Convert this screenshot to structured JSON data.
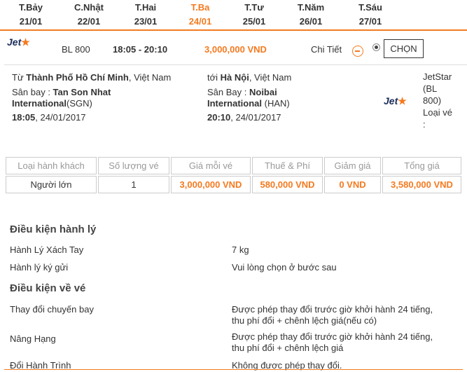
{
  "dates": [
    {
      "weekday": "T.Bảy",
      "date": "21/01",
      "active": false
    },
    {
      "weekday": "C.Nhật",
      "date": "22/01",
      "active": false
    },
    {
      "weekday": "T.Hai",
      "date": "23/01",
      "active": false
    },
    {
      "weekday": "T.Ba",
      "date": "24/01",
      "active": true
    },
    {
      "weekday": "T.Tư",
      "date": "25/01",
      "active": false
    },
    {
      "weekday": "T.Năm",
      "date": "26/01",
      "active": false
    },
    {
      "weekday": "T.Sáu",
      "date": "27/01",
      "active": false
    }
  ],
  "flight": {
    "airline_logo": "Jet",
    "code": "BL 800",
    "time": "18:05 - 20:10",
    "price": "3,000,000 VND",
    "detail_label": "Chi Tiết",
    "select_label": "CHỌN"
  },
  "detail": {
    "from_prefix": "Từ",
    "from_city": "Thành Phố Hồ Chí Minh",
    "from_country": ", Việt Nam",
    "to_prefix": "tới",
    "to_city": "Hà Nội",
    "to_country": ", Việt Nam",
    "from_airport_label": "Sân bay : ",
    "from_airport_name_1": "Tan Son Nhat",
    "from_airport_name_2": "International",
    "from_airport_code": "(SGN)",
    "to_airport_label": "Sân Bay : ",
    "to_airport_name_1": "Noibai",
    "to_airport_name_2": "International",
    "to_airport_code": " (HAN)",
    "depart_time": "18:05",
    "depart_date": ", 24/01/2017",
    "arrive_time": "20:10",
    "arrive_date": ", 24/01/2017",
    "carrier_logo": "Jet",
    "carrier_lines": [
      "JetStar",
      "(BL",
      "800)",
      "Loại vé",
      ":"
    ]
  },
  "fare_table": {
    "headers": [
      "Loại hành khách",
      "Số lượng vé",
      "Giá mỗi vé",
      "Thuế & Phí",
      "Giảm giá",
      "Tổng giá"
    ],
    "row": [
      "Người lớn",
      "1",
      "3,000,000 VND",
      "580,000 VND",
      "0 VND",
      "3,580,000 VND"
    ]
  },
  "baggage": {
    "title": "Điều kiện hành lý",
    "items": [
      {
        "label": "Hành Lý Xách Tay",
        "value": "7 kg"
      },
      {
        "label": "Hành lý ký gửi",
        "value": "Vui lòng chọn ở bước sau"
      }
    ]
  },
  "ticket": {
    "title": "Điều kiện về vé",
    "items": [
      {
        "label": "Thay đổi chuyến bay",
        "value_1": "Được phép thay đổi trước giờ khởi hành 24 tiếng,",
        "value_2": "thu phí đổi + chênh lệch giá(nếu có)"
      },
      {
        "label": "Nâng Hạng",
        "value_1": "Được phép thay đổi trước giờ khởi hành 24 tiếng,",
        "value_2": "thu phí đổi + chênh lệch giá"
      },
      {
        "label": "Đổi Hành Trình",
        "value_1": "Không được phép thay đổi.",
        "value_2": ""
      }
    ]
  },
  "colors": {
    "accent": "#f47a20",
    "logo_text": "#1b2d5a"
  }
}
